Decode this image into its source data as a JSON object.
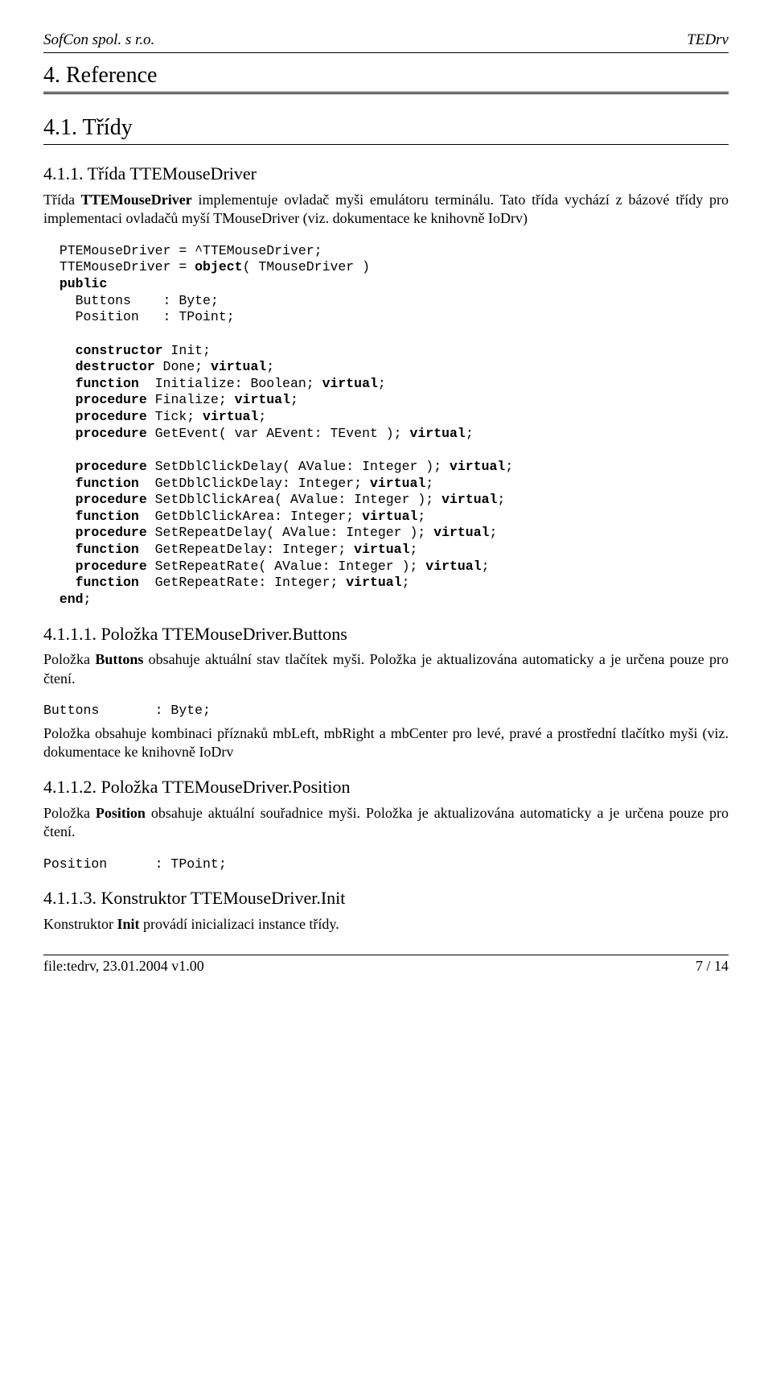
{
  "header": {
    "left": "SofCon spol. s r.o.",
    "right": "TEDrv"
  },
  "h1": "4. Reference",
  "h2": "4.1. Třídy",
  "h3a": "4.1.1. Třída TTEMouseDriver",
  "p1a": "Třída ",
  "p1b": "TTEMouseDriver",
  "p1c": " implementuje ovladač myši emulátoru terminálu. Tato třída vychází z bázové třídy pro implementaci ovladačů myší TMouseDriver (viz. dokumentace ke knihovně IoDrv)",
  "code": {
    "l01a": "PTEMouseDriver = ^TTEMouseDriver;",
    "l02a": "TTEMouseDriver = ",
    "l02b": "object",
    "l02c": "( TMouseDriver )",
    "l03": "public",
    "l04": "    Buttons    : Byte;",
    "l05": "    Position   : TPoint;",
    "l06a": "    ",
    "l06b": "constructor",
    "l06c": " Init;",
    "l07a": "    ",
    "l07b": "destructor",
    "l07c": " Done; ",
    "l07d": "virtual",
    "l07e": ";",
    "l08a": "    ",
    "l08b": "function",
    "l08c": "  Initialize: Boolean; ",
    "l08d": "virtual",
    "l08e": ";",
    "l09a": "    ",
    "l09b": "procedure",
    "l09c": " Finalize; ",
    "l09d": "virtual",
    "l09e": ";",
    "l10a": "    ",
    "l10b": "procedure",
    "l10c": " Tick; ",
    "l10d": "virtual",
    "l10e": ";",
    "l11a": "    ",
    "l11b": "procedure",
    "l11c": " GetEvent( var AEvent: TEvent ); ",
    "l11d": "virtual",
    "l11e": ";",
    "l12a": "    ",
    "l12b": "procedure",
    "l12c": " SetDblClickDelay( AValue: Integer ); ",
    "l12d": "virtual",
    "l12e": ";",
    "l13a": "    ",
    "l13b": "function",
    "l13c": "  GetDblClickDelay: Integer; ",
    "l13d": "virtual",
    "l13e": ";",
    "l14a": "    ",
    "l14b": "procedure",
    "l14c": " SetDblClickArea( AValue: Integer ); ",
    "l14d": "virtual",
    "l14e": ";",
    "l15a": "    ",
    "l15b": "function",
    "l15c": "  GetDblClickArea: Integer; ",
    "l15d": "virtual",
    "l15e": ";",
    "l16a": "    ",
    "l16b": "procedure",
    "l16c": " SetRepeatDelay( AValue: Integer ); ",
    "l16d": "virtual",
    "l16e": ";",
    "l17a": "    ",
    "l17b": "function",
    "l17c": "  GetRepeatDelay: Integer; ",
    "l17d": "virtual",
    "l17e": ";",
    "l18a": "    ",
    "l18b": "procedure",
    "l18c": " SetRepeatRate( AValue: Integer ); ",
    "l18d": "virtual",
    "l18e": ";",
    "l19a": "    ",
    "l19b": "function",
    "l19c": "  GetRepeatRate: Integer; ",
    "l19d": "virtual",
    "l19e": ";",
    "l20": "end",
    "l20b": ";"
  },
  "h3b": "4.1.1.1. Položka TTEMouseDriver.Buttons",
  "p2a": "Položka ",
  "p2b": "Buttons",
  "p2c": " obsahuje aktuální stav tlačítek myši. Položka je aktualizována automaticky a je určena pouze pro čtení.",
  "code2": "Buttons       : Byte;",
  "p3": "Položka obsahuje kombinaci příznaků mbLeft, mbRight a mbCenter pro levé, pravé a prostřední tlačítko myši (viz. dokumentace ke knihovně IoDrv",
  "h3c": "4.1.1.2. Položka TTEMouseDriver.Position",
  "p4a": "Položka ",
  "p4b": "Position",
  "p4c": " obsahuje aktuální souřadnice myši. Položka je aktualizována automaticky a je určena pouze pro čtení.",
  "code3": "Position      : TPoint;",
  "h3d": "4.1.1.3. Konstruktor TTEMouseDriver.Init",
  "p5a": "Konstruktor ",
  "p5b": "Init",
  "p5c": " provádí inicializaci instance třídy.",
  "footer": {
    "left": "file:tedrv, 23.01.2004 v1.00",
    "right": "7 / 14"
  }
}
